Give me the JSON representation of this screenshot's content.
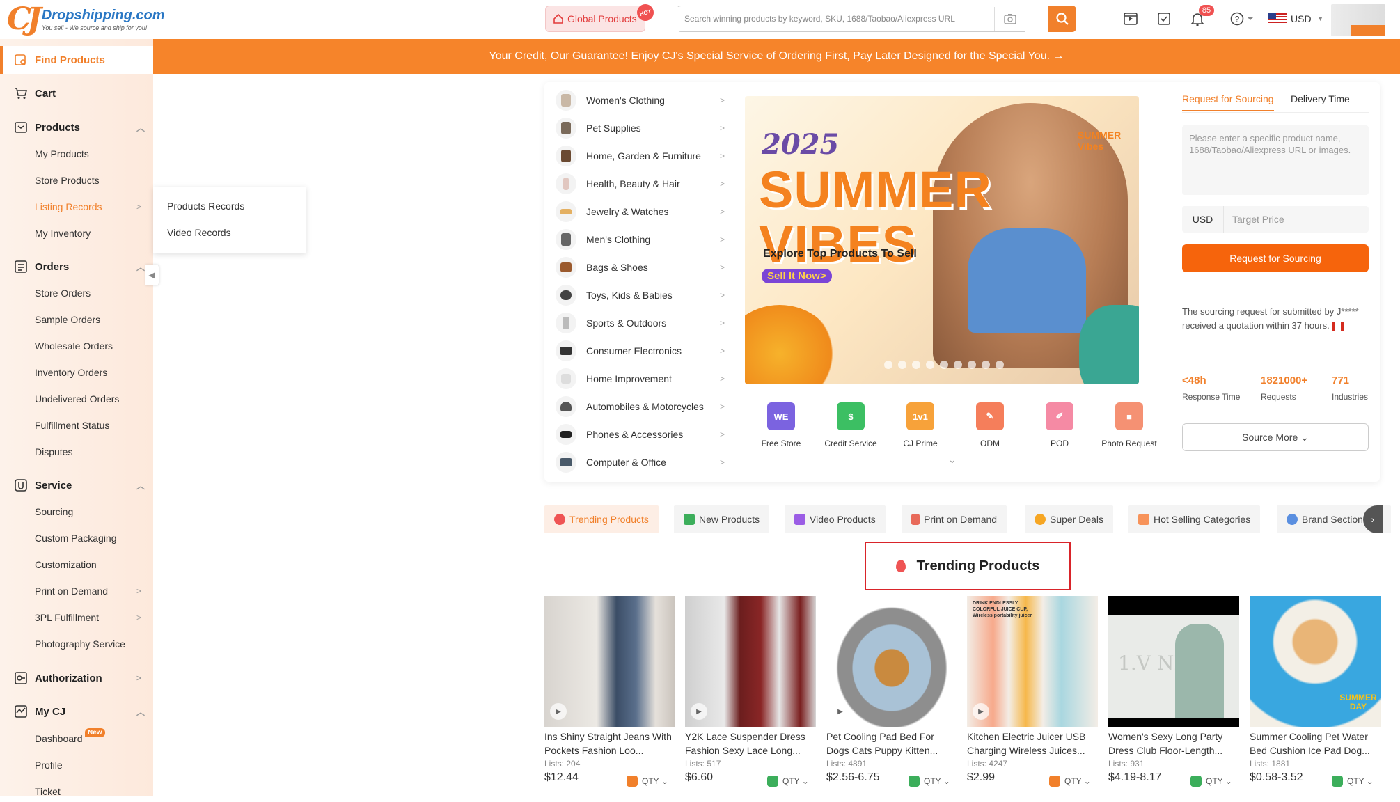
{
  "header": {
    "logo_mark": "CJ",
    "logo_name": "Dropshipping.com",
    "logo_tagline": "You sell - We source and ship for you!",
    "global_products": "Global Products",
    "hot_badge": "HOT",
    "search_placeholder": "Search winning products by keyword, SKU, 1688/Taobao/Aliexpress URL",
    "notification_count": "85",
    "currency": "USD"
  },
  "banner_text": "Your Credit, Our Guarantee! Enjoy CJ's Special Service of Ordering First, Pay Later Designed for the Special You. →",
  "sidebar": {
    "find_products": "Find Products",
    "cart": "Cart",
    "products": "Products",
    "products_items": [
      "My Products",
      "Store Products",
      "Listing Records",
      "My Inventory"
    ],
    "orders": "Orders",
    "orders_items": [
      "Store Orders",
      "Sample Orders",
      "Wholesale Orders",
      "Inventory Orders",
      "Undelivered Orders",
      "Fulfillment Status",
      "Disputes"
    ],
    "service": "Service",
    "service_items": [
      "Sourcing",
      "Custom Packaging",
      "Customization",
      "Print on Demand",
      "3PL Fulfillment",
      "Photography Service"
    ],
    "authorization": "Authorization",
    "mycj": "My CJ",
    "mycj_items": [
      "Dashboard",
      "Profile",
      "Ticket"
    ],
    "new_badge": "New"
  },
  "submenu": [
    "Products Records",
    "Video Records"
  ],
  "categories": [
    "Women's Clothing",
    "Pet Supplies",
    "Home, Garden & Furniture",
    "Health, Beauty & Hair",
    "Jewelry & Watches",
    "Men's Clothing",
    "Bags & Shoes",
    "Toys, Kids & Babies",
    "Sports & Outdoors",
    "Consumer Electronics",
    "Home Improvement",
    "Automobiles & Motorcycles",
    "Phones & Accessories",
    "Computer & Office"
  ],
  "hero": {
    "year": "2025",
    "headline_1": "SUMMER",
    "headline_2": "VIBES",
    "subtitle": "Explore Top Products To Sell",
    "cta": "Sell It Now>",
    "brand": "SUMMER Vibes"
  },
  "services": [
    "Free Store",
    "Credit Service",
    "CJ Prime",
    "ODM",
    "POD",
    "Photo Request"
  ],
  "sourcing": {
    "tab_request": "Request for Sourcing",
    "tab_delivery": "Delivery Time",
    "placeholder": "Please enter a specific product name, 1688/Taobao/Aliexpress URL or images.",
    "currency": "USD",
    "target_price": "Target Price",
    "button": "Request for Sourcing",
    "note": "The sourcing request for submitted by J***** received a quotation within 37 hours.",
    "stats": [
      {
        "value": "<48h",
        "label": "Response Time"
      },
      {
        "value": "1821000+",
        "label": "Requests"
      },
      {
        "value": "771",
        "label": "Industries"
      }
    ],
    "more": "Source More ⌄"
  },
  "tabs": [
    "Trending Products",
    "New Products",
    "Video Products",
    "Print on Demand",
    "Super Deals",
    "Hot Selling Categories",
    "Brand Section"
  ],
  "trending_title": "Trending Products",
  "products": [
    {
      "title": "Ins Shiny Straight Jeans With Pockets Fashion Loo...",
      "lists": "Lists: 204",
      "price": "$12.44",
      "qty": "QTY ⌄"
    },
    {
      "title": "Y2K Lace Suspender Dress Fashion Sexy Lace Long...",
      "lists": "Lists: 517",
      "price": "$6.60",
      "qty": "QTY ⌄"
    },
    {
      "title": "Pet Cooling Pad Bed For Dogs Cats Puppy Kitten...",
      "lists": "Lists: 4891",
      "price": "$2.56-6.75",
      "qty": "QTY ⌄"
    },
    {
      "title": "Kitchen Electric Juicer USB Charging Wireless Juices...",
      "lists": "Lists: 4247",
      "price": "$2.99",
      "qty": "QTY ⌄"
    },
    {
      "title": "Women's Sexy Long Party Dress Club Floor-Length...",
      "lists": "Lists: 931",
      "price": "$4.19-8.17",
      "qty": "QTY ⌄"
    },
    {
      "title": "Summer Cooling Pet Water Bed Cushion Ice Pad Dog...",
      "lists": "Lists: 1881",
      "price": "$0.58-3.52",
      "qty": "QTY ⌄"
    }
  ],
  "product_image_text": {
    "juicer_caption": "DRINK ENDLESSLY COLORFUL JUICE CUP, Wireless portability juicer",
    "dress_caption": "1.V NECK",
    "pet_caption": "SUMMER DAY"
  }
}
